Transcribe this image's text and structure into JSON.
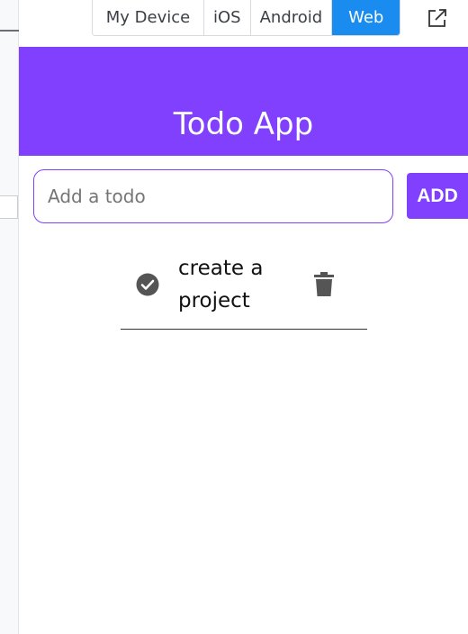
{
  "toolbar": {
    "platforms": [
      "My Device",
      "iOS",
      "Android",
      "Web"
    ],
    "selected": "Web",
    "open_external_icon": "external-link-icon",
    "accent_color": "#1a8cf0"
  },
  "app": {
    "title": "Todo App",
    "header_color": "#8140fd",
    "input": {
      "placeholder": "Add a todo",
      "value": ""
    },
    "add_label": "ADD",
    "todos": [
      {
        "text": "create a project",
        "done": true
      }
    ],
    "icons": {
      "complete": "check-circle-icon",
      "delete": "trash-icon"
    }
  }
}
